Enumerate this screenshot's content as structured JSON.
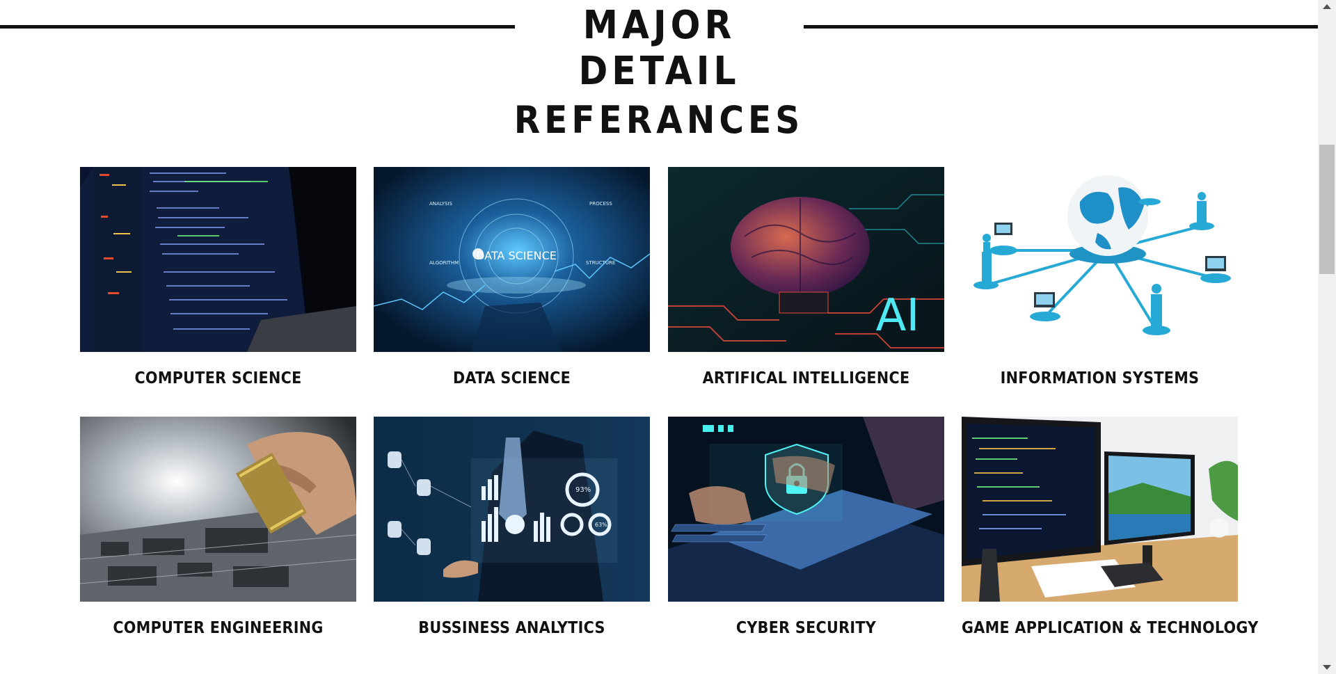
{
  "header": {
    "title": "MAJOR DETAIL"
  },
  "section": {
    "title": "REFERANCES"
  },
  "majors": [
    {
      "label": "COMPUTER SCIENCE"
    },
    {
      "label": "DATA SCIENCE",
      "image_text": "DATA SCIENCE",
      "image_tags": [
        "ANALYSIS",
        "PROCESS",
        "ALGORITHM",
        "STRUCTURE"
      ]
    },
    {
      "label": "ARTIFICAL INTELLIGENCE",
      "image_text": "AI"
    },
    {
      "label": "INFORMATION SYSTEMS"
    },
    {
      "label": "COMPUTER ENGINEERING"
    },
    {
      "label": "BUSSINESS ANALYTICS",
      "image_text": [
        "93%",
        "63%"
      ]
    },
    {
      "label": "CYBER SECURITY"
    },
    {
      "label": "GAME APPLICATION & TECHNOLOGY"
    }
  ],
  "colors": {
    "text": "#111111",
    "background": "#ffffff",
    "accent_cyan": "#20c0e0"
  }
}
